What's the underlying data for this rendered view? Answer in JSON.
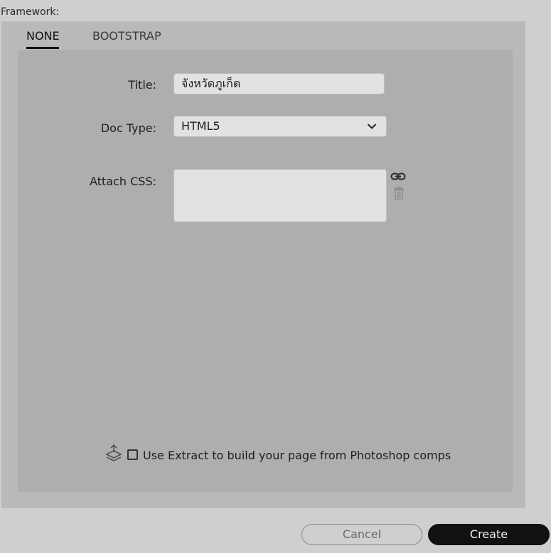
{
  "dialog": {
    "framework_label": "Framework:",
    "tabs": [
      {
        "label": "NONE",
        "active": true
      },
      {
        "label": "BOOTSTRAP",
        "active": false
      }
    ]
  },
  "form": {
    "title_label": "Title:",
    "title_value": "จังหวัดภูเก็ต",
    "doctype_label": "Doc Type:",
    "doctype_value": "HTML5",
    "attach_css_label": "Attach CSS:",
    "attach_css_items": []
  },
  "extract": {
    "label": "Use Extract to build your page from Photoshop comps",
    "checked": false
  },
  "footer": {
    "cancel_label": "Cancel",
    "create_label": "Create"
  },
  "icons": {
    "link": "link-icon",
    "trash": "trash-icon",
    "extract": "layers-upload-icon",
    "dropdown": "chevron-down-icon"
  },
  "colors": {
    "background": "#cfcfcf",
    "panel": "#b9b9b9",
    "inner_panel": "#aeaeae",
    "create_button": "#111111"
  }
}
